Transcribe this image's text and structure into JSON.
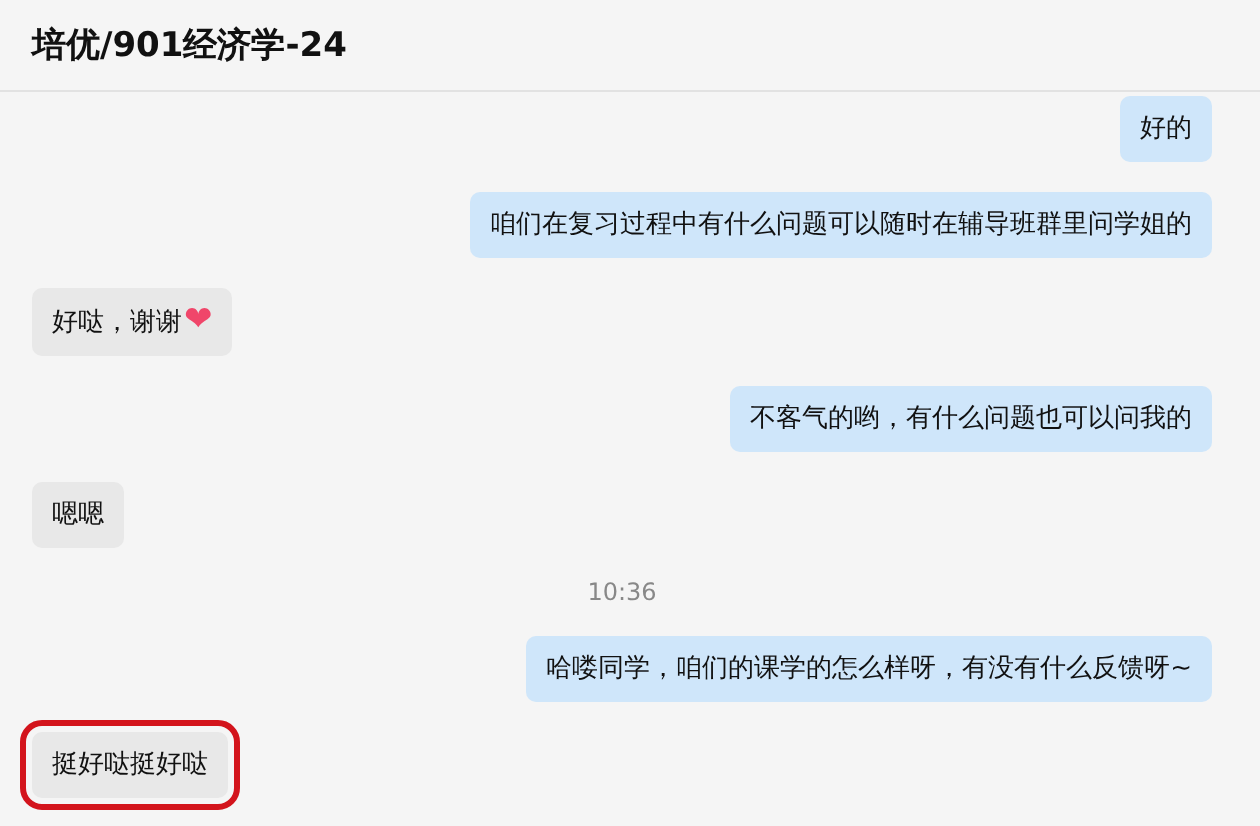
{
  "window": {
    "title": "培优/901经济学-24"
  },
  "messages": [
    {
      "kind": "sent",
      "text": "好的",
      "highlighted": false
    },
    {
      "kind": "sent",
      "text": "咱们在复习过程中有什么问题可以随时在辅导班群里问学姐的",
      "highlighted": false
    },
    {
      "kind": "received",
      "text": "好哒，谢谢",
      "emoji": "❤",
      "highlighted": false
    },
    {
      "kind": "sent",
      "text": "不客气的哟，有什么问题也可以问我的",
      "highlighted": false
    },
    {
      "kind": "received",
      "text": "嗯嗯",
      "highlighted": false
    },
    {
      "kind": "time",
      "text": "10:36"
    },
    {
      "kind": "sent",
      "text": "哈喽同学，咱们的课学的怎么样呀，有没有什么反馈呀~",
      "highlighted": false
    },
    {
      "kind": "received",
      "text": "挺好哒挺好哒",
      "highlighted": true
    }
  ]
}
